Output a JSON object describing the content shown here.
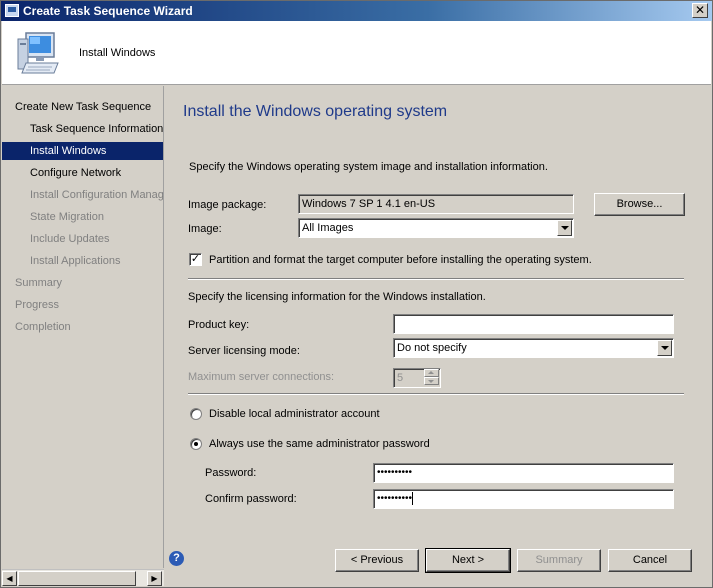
{
  "window": {
    "title": "Create Task Sequence Wizard",
    "close_glyph": "✕"
  },
  "header": {
    "step_title": "Install Windows"
  },
  "nav": [
    {
      "label": "Create New Task Sequence",
      "state": "normal",
      "indent": 0
    },
    {
      "label": "Task Sequence Information",
      "state": "normal",
      "indent": 1
    },
    {
      "label": "Install Windows",
      "state": "active",
      "indent": 1
    },
    {
      "label": "Configure Network",
      "state": "normal",
      "indent": 1
    },
    {
      "label": "Install Configuration Manager",
      "state": "disabled",
      "indent": 1
    },
    {
      "label": "State Migration",
      "state": "disabled",
      "indent": 1
    },
    {
      "label": "Include Updates",
      "state": "disabled",
      "indent": 1
    },
    {
      "label": "Install Applications",
      "state": "disabled",
      "indent": 1
    },
    {
      "label": "Summary",
      "state": "disabled",
      "indent": 0
    },
    {
      "label": "Progress",
      "state": "disabled",
      "indent": 0
    },
    {
      "label": "Completion",
      "state": "disabled",
      "indent": 0
    }
  ],
  "main": {
    "heading": "Install the Windows operating system",
    "intro": "Specify the Windows operating system image and installation information.",
    "image_package_label": "Image package:",
    "image_package_value": "Windows 7 SP 1 4.1 en-US",
    "browse_label": "Browse...",
    "image_label": "Image:",
    "image_value": "All Images",
    "partition_label": "Partition and format the target computer before installing the operating system.",
    "partition_checked": true,
    "licensing_intro": "Specify the licensing information for the Windows installation.",
    "product_key_label": "Product key:",
    "product_key_value": "",
    "server_mode_label": "Server licensing mode:",
    "server_mode_value": "Do not specify",
    "max_conn_label": "Maximum server connections:",
    "max_conn_value": "5",
    "disable_admin_label": "Disable local administrator account",
    "same_password_label": "Always use the same administrator password",
    "selected_radio": "same_password",
    "password_label": "Password:",
    "password_value": "••••••••••",
    "confirm_label": "Confirm password:",
    "confirm_value": "••••••••••"
  },
  "footer": {
    "help_glyph": "?",
    "previous_label": "< Previous",
    "next_label": "Next >",
    "summary_label": "Summary",
    "cancel_label": "Cancel"
  },
  "scrollbar": {
    "left_glyph": "◀",
    "right_glyph": "▶"
  }
}
